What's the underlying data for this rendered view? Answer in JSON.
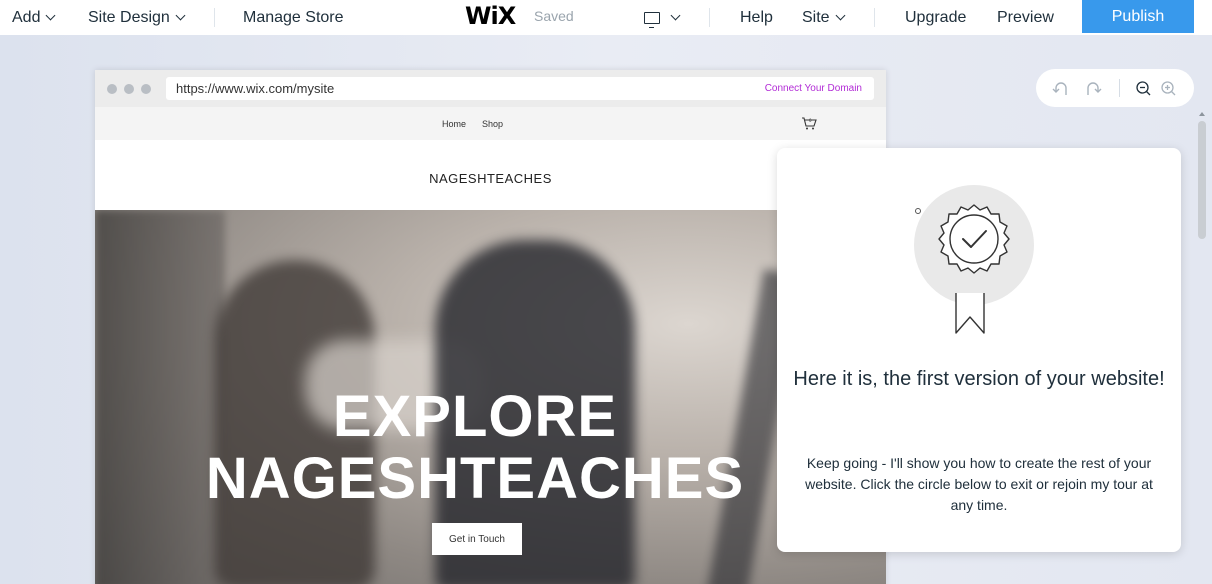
{
  "topbar": {
    "add": "Add",
    "site_design": "Site Design",
    "manage_store": "Manage Store",
    "logo": "WiX",
    "saved": "Saved",
    "help": "Help",
    "site": "Site",
    "upgrade": "Upgrade",
    "preview": "Preview",
    "publish": "Publish"
  },
  "browser": {
    "url": "https://www.wix.com/mysite",
    "connect_domain": "Connect Your Domain"
  },
  "site": {
    "nav": [
      "Home",
      "Shop"
    ],
    "name": "NAGESHTEACHES",
    "hero_title_line1": "EXPLORE",
    "hero_title_line2": "NAGESHTEACHES",
    "cta": "Get in Touch"
  },
  "tour": {
    "title": "Here it is, the first version of your website!",
    "body": "Keep going - I'll show you how to create the rest of your website. Click the circle below to exit or rejoin my tour at any time."
  },
  "colors": {
    "publish_bg": "#3899ec",
    "connect_domain": "#b22bd6",
    "canvas_bg": "#e8ebf3"
  },
  "icons": [
    "chevron-down-icon",
    "desktop-icon",
    "cart-icon",
    "undo-icon",
    "redo-icon",
    "zoom-out-icon",
    "zoom-in-icon",
    "award-badge-icon"
  ]
}
